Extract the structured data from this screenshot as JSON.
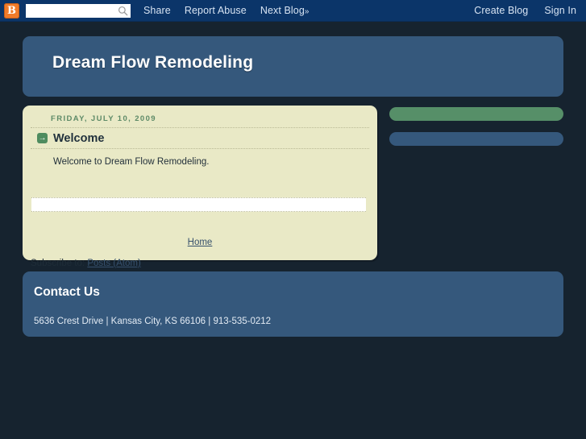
{
  "navbar": {
    "logo_icon": "blogger-logo-icon",
    "logo_letter": "B",
    "search": {
      "value": "",
      "placeholder": "",
      "icon": "search-icon"
    },
    "left_links": [
      {
        "label": "Share",
        "name": "share-link"
      },
      {
        "label": "Report Abuse",
        "name": "report-abuse-link"
      },
      {
        "label": "Next Blog",
        "suffix": "»",
        "name": "next-blog-link"
      }
    ],
    "right_links": [
      {
        "label": "Create Blog",
        "name": "create-blog-link"
      },
      {
        "label": "Sign In",
        "name": "sign-in-link"
      }
    ]
  },
  "header": {
    "title": "Dream Flow Remodeling"
  },
  "post": {
    "date": "FRIDAY, JULY 10, 2009",
    "title": "Welcome",
    "title_icon": "arrow-right-icon",
    "body": "Welcome to Dream Flow Remodeling.",
    "home_link": "Home",
    "subscribe_label": "Subscribe to:",
    "subscribe_link": "Posts (Atom)"
  },
  "sidebar": {
    "widgets": [
      {
        "name": "sidebar-widget-green",
        "color": "#568f68"
      },
      {
        "name": "sidebar-widget-blue",
        "color": "#35587c"
      }
    ]
  },
  "footer": {
    "title": "Contact Us",
    "address": "5636 Crest Drive | Kansas City, KS 66106 | 913-535-0212"
  },
  "colors": {
    "page_background": "#16232f",
    "navbar_background": "#0b3569",
    "panel_blue": "#35587c",
    "panel_cream": "#e9e9c6",
    "accent_green": "#4f8c5f",
    "date_green": "#5d8a67",
    "logo_orange": "#f07b2a"
  }
}
